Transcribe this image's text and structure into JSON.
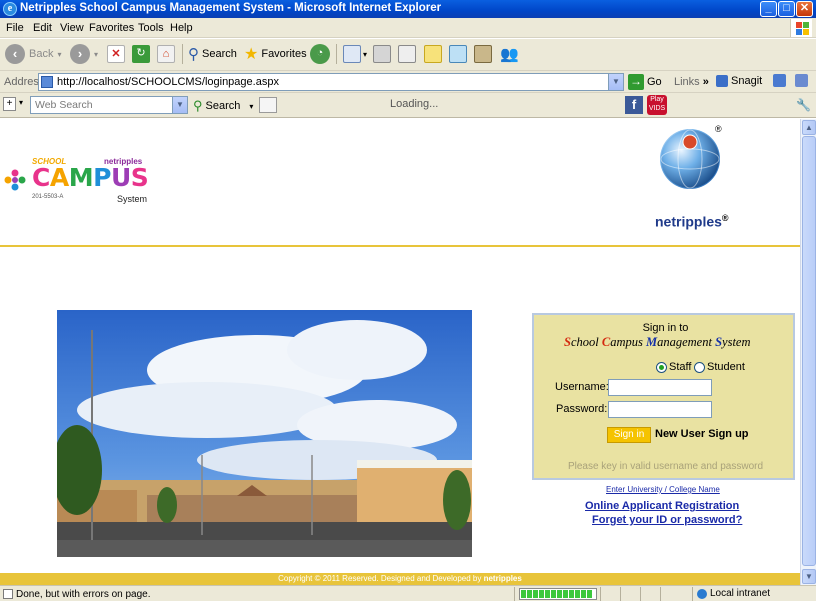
{
  "window": {
    "title": "Netripples School Campus Management System - Microsoft Internet Explorer",
    "minimize": "_",
    "maximize": "□",
    "close": "✕"
  },
  "menu": [
    "File",
    "Edit",
    "View",
    "Favorites",
    "Tools",
    "Help"
  ],
  "toolbar": {
    "back": "Back",
    "search": "Search",
    "favorites": "Favorites"
  },
  "address": {
    "label": "Address",
    "url": "http://localhost/SCHOOLCMS/loginpage.aspx",
    "go": "Go",
    "links": "Links",
    "snagit": "Snagit"
  },
  "searchbar": {
    "placeholder": "Web Search",
    "search": "Search",
    "loading": "Loading...",
    "playvids": "Play VIDS"
  },
  "logo": {
    "school": "SCHOOL",
    "netripples_small": "netripples",
    "campus": [
      "C",
      "A",
      "M",
      "P",
      "U",
      "S"
    ],
    "registration": "201-5503-A",
    "system": "System"
  },
  "brand": {
    "netripples": "netripples",
    "reg": "®"
  },
  "login": {
    "signin_to": "Sign in to",
    "system_name_parts": [
      {
        "t": "S",
        "c": "r"
      },
      {
        "t": "chool ",
        "c": ""
      },
      {
        "t": "C",
        "c": "r"
      },
      {
        "t": "ampus ",
        "c": ""
      },
      {
        "t": "M",
        "c": "b"
      },
      {
        "t": "anagement ",
        "c": ""
      },
      {
        "t": "S",
        "c": "b"
      },
      {
        "t": "ystem",
        "c": ""
      }
    ],
    "role_staff": "Staff",
    "role_student": "Student",
    "username_label": "Username:",
    "password_label": "Password:",
    "signin_button": "Sign in",
    "new_user": "New User Sign up",
    "hint": "Please key in valid username and password"
  },
  "links": {
    "university": "Enter University / College Name",
    "applicant": "Online Applicant Registration",
    "forgot": "Forget your ID or password?"
  },
  "footer": {
    "text": "Copyright © 2011 Reserved. Designed and Developed by",
    "brand": "netripples"
  },
  "status": {
    "text": "Done, but with errors on page.",
    "zone": "Local intranet",
    "progress_fraction": 1.0
  },
  "colors": {
    "yellow_accent": "#e8c43a",
    "login_bg": "#e9e2a2",
    "link_blue": "#1a2aa8"
  }
}
